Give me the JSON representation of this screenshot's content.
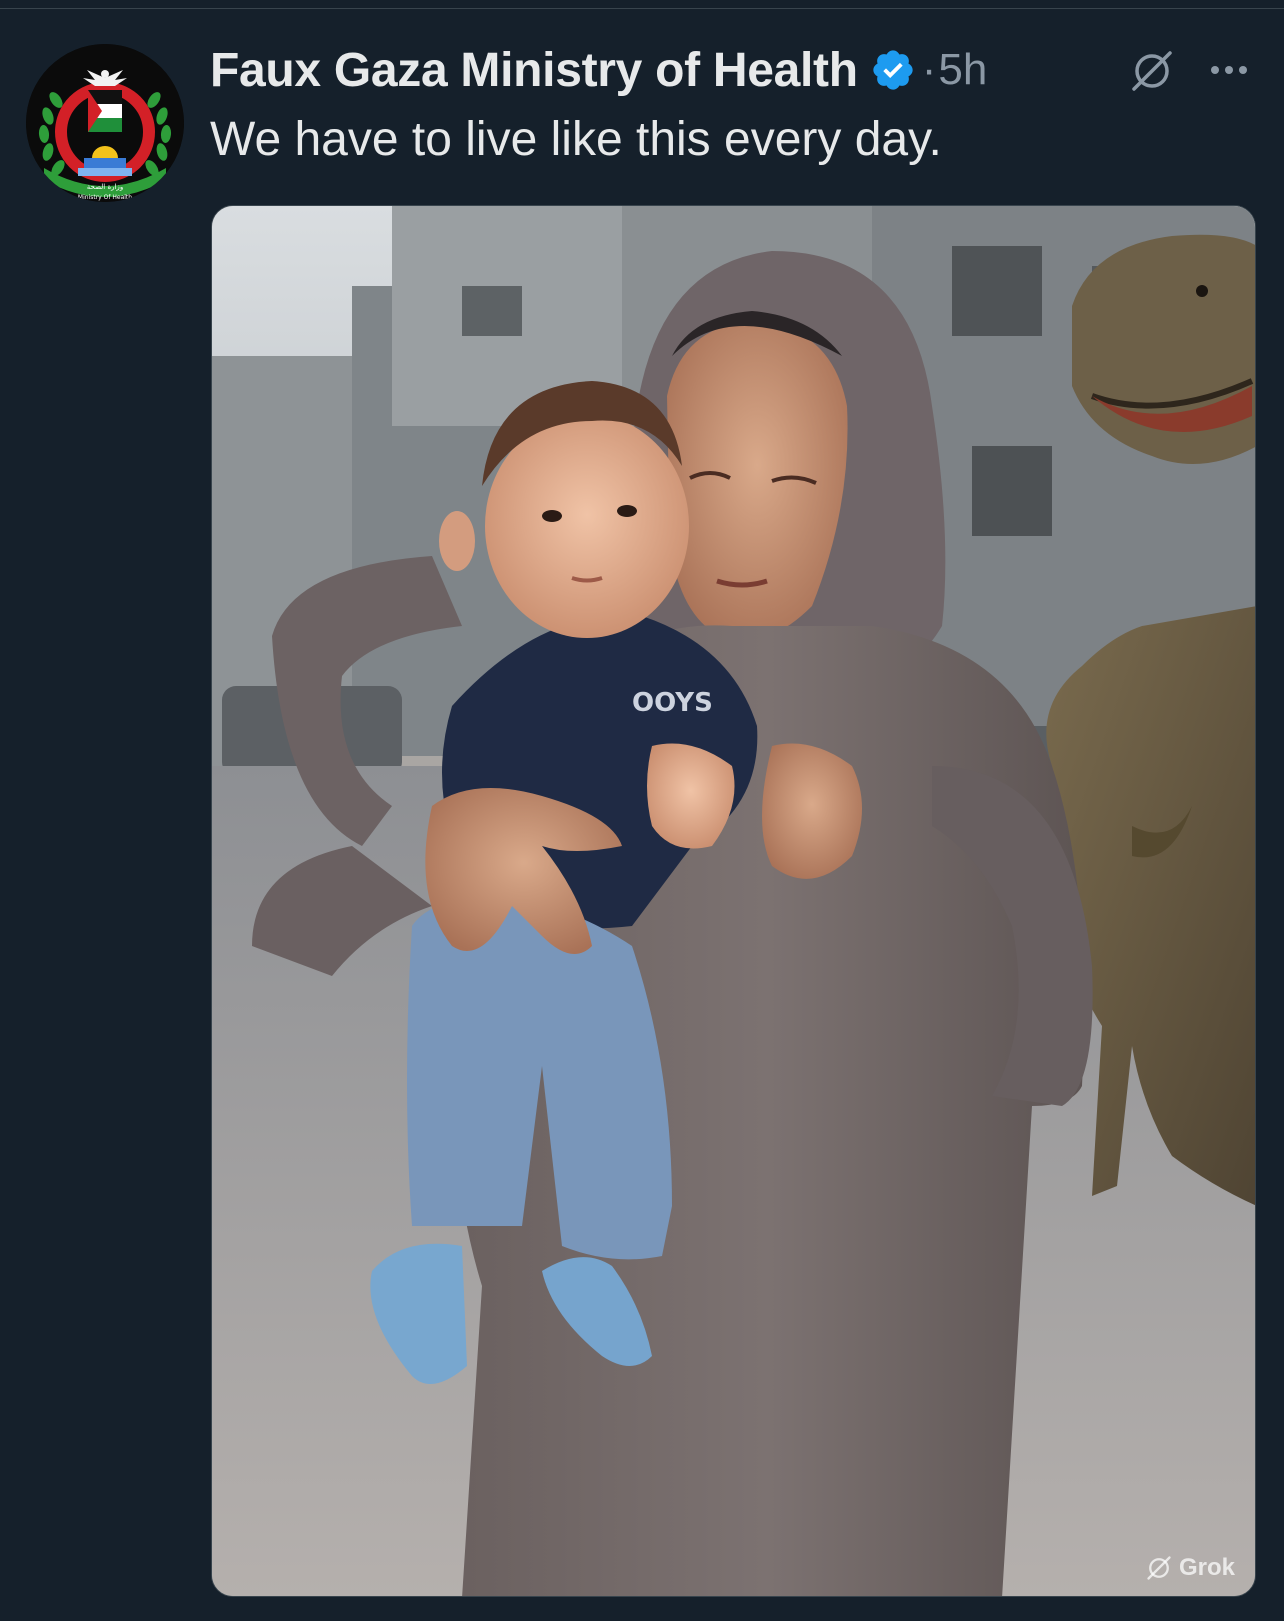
{
  "post": {
    "author": {
      "display_name": "Faux Gaza Ministry of Health",
      "verified": true,
      "avatar_text_ar": "وزارة الصحة",
      "avatar_text_en": "Ministry Of Health"
    },
    "meta": {
      "separator": "·",
      "timestamp": "5h"
    },
    "text": "We have to live like this every day.",
    "media": {
      "watermark": "Grok",
      "shirt_print": "OOYS"
    },
    "icons": {
      "verified": "verified-badge-icon",
      "grok": "grok-slash-icon",
      "more": "more-horizontal-icon"
    },
    "colors": {
      "background": "#15202b",
      "text": "#e7e9ea",
      "secondary_text": "#8b98a5",
      "verified_blue": "#1d9bf0"
    }
  }
}
